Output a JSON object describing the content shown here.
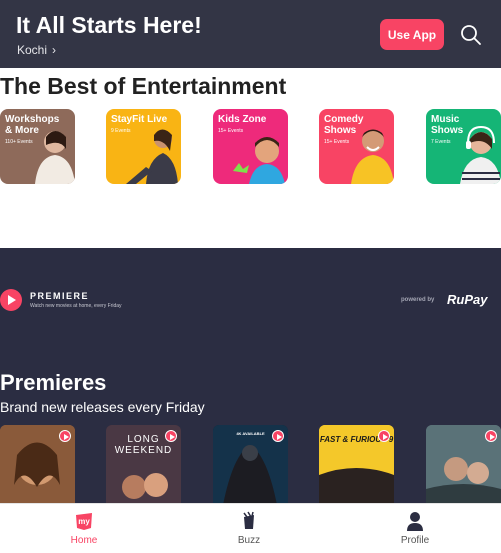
{
  "header": {
    "title": "It All Starts Here!",
    "city": "Kochi",
    "use_app_label": "Use App",
    "search_icon": "search-icon"
  },
  "entertainment": {
    "title": "The Best of Entertainment",
    "categories": [
      {
        "name": "Workshops & More",
        "count": "110+ Events",
        "color": "#8e6a5a"
      },
      {
        "name": "StayFit Live",
        "count": "9 Events",
        "color": "#f9b414"
      },
      {
        "name": "Kids Zone",
        "count": "15+ Events",
        "color": "#ee2a7b"
      },
      {
        "name": "Comedy Shows",
        "count": "15+ Events",
        "color": "#f84464"
      },
      {
        "name": "Music Shows",
        "count": "7 Events",
        "color": "#15b576"
      }
    ]
  },
  "premiere_banner": {
    "brand": "PREMIERE",
    "tagline": "Watch new movies at home, every Friday",
    "powered_by": "powered by",
    "partner": "RuPay"
  },
  "premieres": {
    "title": "Premieres",
    "subtitle": "Brand new releases every Friday",
    "posters": [
      {
        "text": ""
      },
      {
        "text": "LONG WEEKEND"
      },
      {
        "text": "4K AVAILABLE"
      },
      {
        "text": "FAST & FURIOUS 9"
      },
      {
        "text": ""
      }
    ]
  },
  "bottom_nav": {
    "items": [
      {
        "label": "Home",
        "icon": "home-icon",
        "active": true
      },
      {
        "label": "Buzz",
        "icon": "buzz-icon",
        "active": false
      },
      {
        "label": "Profile",
        "icon": "profile-icon",
        "active": false
      }
    ]
  },
  "colors": {
    "brand": "#f84464",
    "header_bg": "#333545",
    "dark_section_bg": "#2b2d42"
  }
}
